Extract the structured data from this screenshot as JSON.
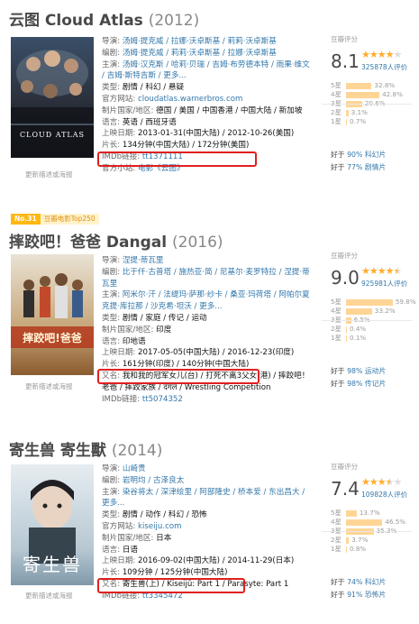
{
  "colors": {
    "highlight": "#e02020",
    "link": "#3377aa",
    "star": "#ffac2d",
    "bar": "#ffd596"
  },
  "movies": [
    {
      "title": "云图 Cloud Atlas",
      "year": "(2012)",
      "poster_text": "CLOUD ATLAS",
      "poster_caption": "更新描述或海报",
      "info": [
        {
          "label": "导演:",
          "value": "汤姆·提克威 / 拉娜·沃卓斯基 / 莉莉·沃卓斯基"
        },
        {
          "label": "编剧:",
          "value": "汤姆·提克威 / 莉莉·沃卓斯基 / 拉娜·沃卓斯基"
        },
        {
          "label": "主演:",
          "value": "汤姆·汉克斯 / 哈莉·贝瑞 / 吉姆·布劳德本特 / 雨果·维文 / 吉姆·斯特吉斯 / 更多..."
        },
        {
          "label": "类型:",
          "value": "剧情 / 科幻 / 悬疑"
        },
        {
          "label": "官方网站:",
          "value": "cloudatlas.warnerbros.com"
        },
        {
          "label": "制片国家/地区:",
          "value": "德国 / 美国 / 中国香港 / 中国大陆 / 新加坡"
        },
        {
          "label": "语言:",
          "value": "英语 / 西班牙语"
        },
        {
          "label": "上映日期:",
          "value": "2013-01-31(中国大陆) / 2012-10-26(美国)"
        },
        {
          "label": "片长:",
          "value": "134分钟(中国大陆) / 172分钟(美国)"
        },
        {
          "label": "IMDb链接:",
          "value": "tt1371111"
        },
        {
          "label": "官方小站:",
          "value": "电影《云图》"
        }
      ],
      "rating_label": "豆瓣评分",
      "score": "8.1",
      "stars": 4,
      "votes": "325878人评价",
      "distribution": [
        {
          "label": "5星",
          "pct": "32.8%",
          "value": 32.8
        },
        {
          "label": "4星",
          "pct": "42.8%",
          "value": 42.8
        },
        {
          "label": "3星",
          "pct": "20.6%",
          "value": 20.6
        },
        {
          "label": "2星",
          "pct": "3.1%",
          "value": 3.1
        },
        {
          "label": "1星",
          "pct": "0.7%",
          "value": 0.7
        }
      ],
      "better_than": [
        {
          "prefix": "好于",
          "pct": "90% 科幻片"
        },
        {
          "prefix": "好于",
          "pct": "77% 剧情片"
        }
      ]
    },
    {
      "badge_no": "No.31",
      "badge_text": "豆瓣电影Top250",
      "title": "摔跤吧！爸爸 Dangal",
      "year": "(2016)",
      "poster_text": "摔跤吧!爸爸",
      "poster_caption": "更新描述或海报",
      "info": [
        {
          "label": "导演:",
          "value": "涅提·蒂瓦里"
        },
        {
          "label": "编剧:",
          "value": "比于仟·古普塔 / 施热亚·简 / 尼基尔·麦罗特拉 / 涅提·蒂瓦里"
        },
        {
          "label": "主演:",
          "value": "阿米尔·汗 / 法缇玛·萨那·纱卡 / 桑亚·玛荷塔 / 阿帕尔夏克提·库拉那 / 沙克希·坦沃 / 更多..."
        },
        {
          "label": "类型:",
          "value": "剧情 / 家庭 / 传记 / 运动"
        },
        {
          "label": "制片国家/地区:",
          "value": "印度"
        },
        {
          "label": "语言:",
          "value": "印地语"
        },
        {
          "label": "上映日期:",
          "value": "2017-05-05(中国大陆) / 2016-12-23(印度)"
        },
        {
          "label": "片长:",
          "value": "161分钟(印度) / 140分钟(中国大陆)"
        },
        {
          "label": "又名:",
          "value": "我和我的冠军女儿(台) / 打死不离3父女(港) / 摔跤吧！老爸 / 摔跤家族 / दंगल / Wrestling Competition"
        },
        {
          "label": "IMDb链接:",
          "value": "tt5074352"
        }
      ],
      "rating_label": "豆瓣评分",
      "score": "9.0",
      "stars": 4.5,
      "votes": "925981人评价",
      "distribution": [
        {
          "label": "5星",
          "pct": "59.8%",
          "value": 59.8
        },
        {
          "label": "4星",
          "pct": "33.2%",
          "value": 33.2
        },
        {
          "label": "3星",
          "pct": "6.5%",
          "value": 6.5
        },
        {
          "label": "2星",
          "pct": "0.4%",
          "value": 0.4
        },
        {
          "label": "1星",
          "pct": "0.1%",
          "value": 0.1
        }
      ],
      "better_than": [
        {
          "prefix": "好于",
          "pct": "98% 运动片"
        },
        {
          "prefix": "好于",
          "pct": "98% 传记片"
        }
      ]
    },
    {
      "title": "寄生兽 寄生獸",
      "year": "(2014)",
      "poster_text": "寄生兽",
      "poster_caption": "更新描述或海报",
      "info": [
        {
          "label": "导演:",
          "value": "山崎贵"
        },
        {
          "label": "编剧:",
          "value": "岩明均 / 古泽良太"
        },
        {
          "label": "主演:",
          "value": "染谷将太 / 深津绘里 / 阿部隆史 / 桥本爱 / 东出昌大 / 更多..."
        },
        {
          "label": "类型:",
          "value": "剧情 / 动作 / 科幻 / 恐怖"
        },
        {
          "label": "官方网站:",
          "value": "kiseiju.com"
        },
        {
          "label": "制片国家/地区:",
          "value": "日本"
        },
        {
          "label": "语言:",
          "value": "日语"
        },
        {
          "label": "上映日期:",
          "value": "2016-09-02(中国大陆) / 2014-11-29(日本)"
        },
        {
          "label": "片长:",
          "value": "109分钟 / 125分钟(中国大陆)"
        },
        {
          "label": "又名:",
          "value": "寄生兽(上) / Kiseijû: Part 1 / Parasyte: Part 1"
        },
        {
          "label": "IMDb链接:",
          "value": "tt3345472"
        }
      ],
      "rating_label": "豆瓣评分",
      "score": "7.4",
      "stars": 3.5,
      "votes": "109828人评价",
      "distribution": [
        {
          "label": "5星",
          "pct": "13.7%",
          "value": 13.7
        },
        {
          "label": "4星",
          "pct": "46.5%",
          "value": 46.5
        },
        {
          "label": "3星",
          "pct": "35.3%",
          "value": 35.3
        },
        {
          "label": "2星",
          "pct": "3.7%",
          "value": 3.7
        },
        {
          "label": "1星",
          "pct": "0.8%",
          "value": 0.8
        }
      ],
      "better_than": [
        {
          "prefix": "好于",
          "pct": "74% 科幻片"
        },
        {
          "prefix": "好于",
          "pct": "91% 恐怖片"
        }
      ]
    }
  ]
}
